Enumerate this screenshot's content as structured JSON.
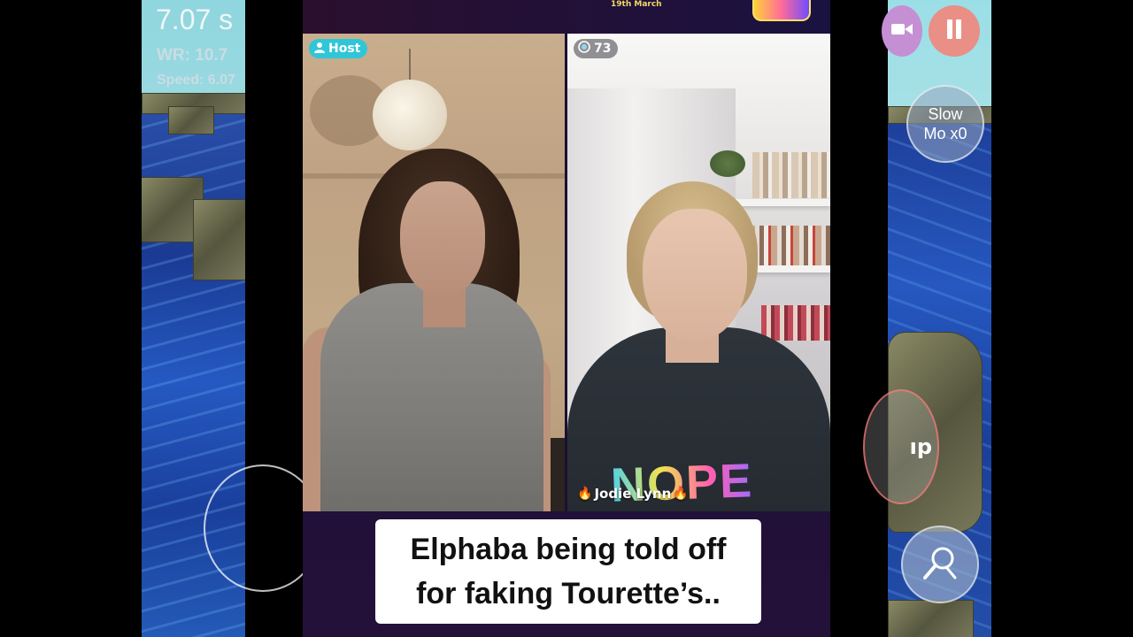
{
  "left_game": {
    "timer_text": "7.07 s",
    "world_record_text": "WR: 10.7",
    "speed_text": "Speed: 6.07"
  },
  "right_game": {
    "slow_mo_line1": "Slow",
    "slow_mo_line2": "Mo x0",
    "jump_label_partial": "ıp"
  },
  "live_stream": {
    "top_date_text": "19th March",
    "host_badge_label": "Host",
    "viewer_count": "73",
    "guest_name": "Jodie Lynn",
    "shirt_text": "NOPE",
    "caption_line1": "Elphaba being told off",
    "caption_line2": "for faking Tourette’s.."
  },
  "colors": {
    "host_badge": "#2fc6d8",
    "record_button": "#c58fd4",
    "pause_button": "#e98f85",
    "caption_background": "#ffffff"
  },
  "icons": {
    "host_badge": "person-icon",
    "viewer_badge": "viewers-icon",
    "record": "video-camera-icon",
    "pause": "pause-icon",
    "tool": "magnifier-tool-icon",
    "guest_name_decoration": "flame-icon"
  }
}
